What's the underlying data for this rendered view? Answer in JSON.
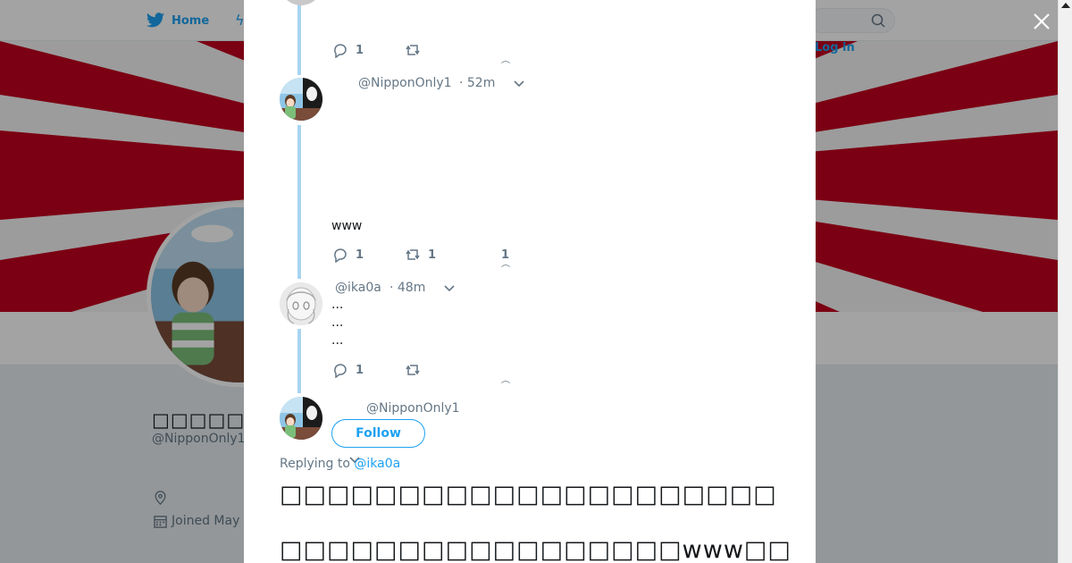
{
  "nav": {
    "home_label": "Home",
    "login_label": "Log in"
  },
  "profile": {
    "name": "□□□□□□□□□□□",
    "handle": "@NipponOnly1",
    "joined": "Joined May"
  },
  "colors": {
    "twitter_blue": "#1da1f2",
    "banner_red": "#c0001e",
    "thread_line": "#a8d4f0"
  },
  "thread": {
    "tweet1": {
      "reply_count": "1",
      "more_mark": "⌒"
    },
    "tweet2": {
      "handle": "@NipponOnly1",
      "time": "· 52m",
      "text": "www",
      "reply_count": "1",
      "retweet_count": "1",
      "like_count": "1",
      "more_mark": "⌒"
    },
    "tweet3": {
      "handle": "@ika0a",
      "time": "· 48m",
      "lines": [
        "...",
        "...",
        "..."
      ],
      "reply_count": "1",
      "more_mark": "⌒"
    },
    "main_tweet": {
      "handle": "@NipponOnly1",
      "follow_label": "Follow",
      "replying_prefix": "Replying to",
      "replying_handle": "@ika0a",
      "line1": "□□□□□□□□□□□□□□□□□□□□□",
      "line2": "□□□□□□□□□□□□□□□□□www□□"
    }
  },
  "icons": [
    "twitter-bird-icon",
    "search-icon",
    "close-icon",
    "reply-icon",
    "retweet-icon",
    "chevron-down-icon",
    "location-icon",
    "calendar-icon"
  ]
}
